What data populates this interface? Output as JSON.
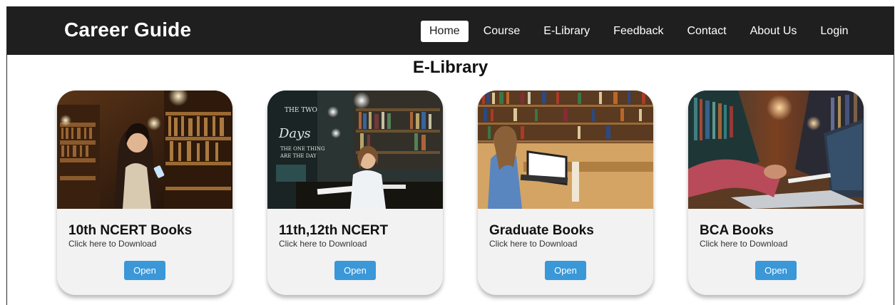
{
  "header": {
    "brand": "Career Guide",
    "nav": [
      {
        "label": "Home",
        "active": true
      },
      {
        "label": "Course"
      },
      {
        "label": "E-Library"
      },
      {
        "label": "Feedback"
      },
      {
        "label": "Contact"
      },
      {
        "label": "About Us"
      },
      {
        "label": "Login"
      }
    ]
  },
  "main": {
    "title": "E-Library",
    "cards": [
      {
        "title": "10th NCERT Books",
        "subtitle": "Click here to Download",
        "button": "Open",
        "image": "girl-reading-phone-in-library-photo"
      },
      {
        "title": "11th,12th NCERT",
        "subtitle": "Click here to Download",
        "button": "Open",
        "image": "student-writing-at-library-desk-photo"
      },
      {
        "title": "Graduate Books",
        "subtitle": "Click here to Download",
        "button": "Open",
        "image": "student-with-laptop-in-library-photo"
      },
      {
        "title": "BCA Books",
        "subtitle": "Click here to Download",
        "button": "Open",
        "image": "hands-typing-laptop-in-library-photo"
      }
    ]
  },
  "colors": {
    "navbar": "#1f1f1f",
    "button": "#3a97d8",
    "card": "#f2f2f2"
  }
}
